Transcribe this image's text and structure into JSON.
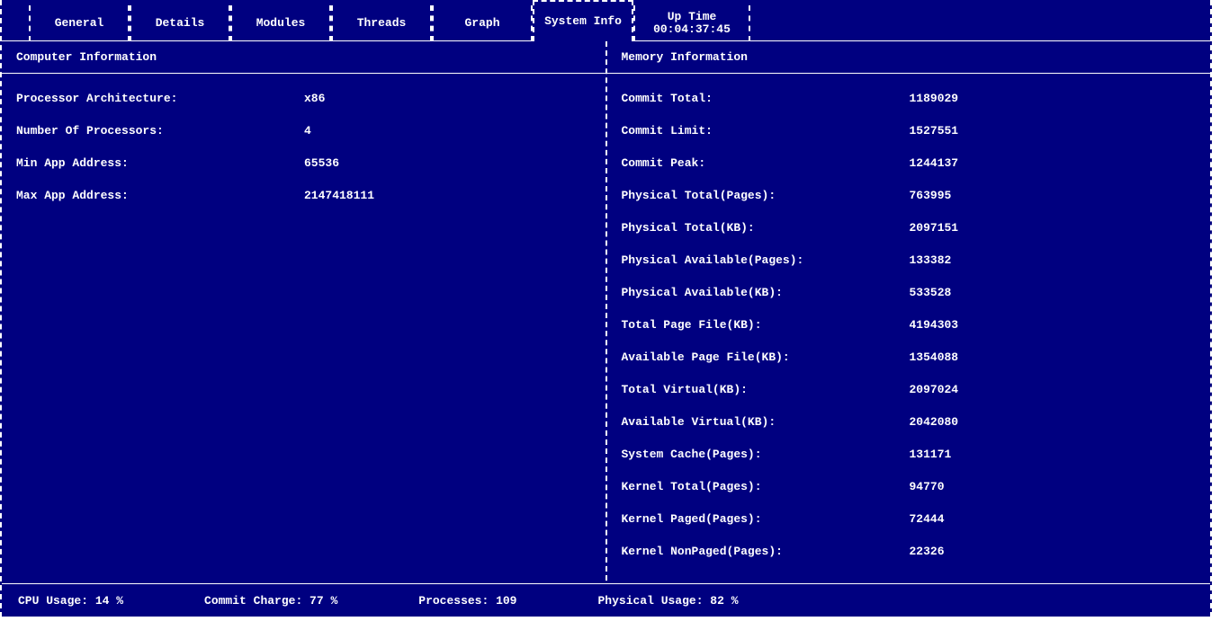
{
  "tabs": {
    "general": "General",
    "details": "Details",
    "modules": "Modules",
    "threads": "Threads",
    "graph": "Graph",
    "system_info": "System Info",
    "uptime_label": "Up Time",
    "uptime_value": "00:04:37:45"
  },
  "panel_left": {
    "title": "Computer Information",
    "rows": {
      "proc_arch_label": "Processor Architecture:",
      "proc_arch_value": "x86",
      "num_proc_label": "Number Of Processors:",
      "num_proc_value": "4",
      "min_app_label": "Min App Address:",
      "min_app_value": "65536",
      "max_app_label": "Max App Address:",
      "max_app_value": "2147418111"
    }
  },
  "panel_right": {
    "title": "Memory Information",
    "rows": {
      "commit_total_label": "Commit Total:",
      "commit_total_value": "1189029",
      "commit_limit_label": "Commit Limit:",
      "commit_limit_value": "1527551",
      "commit_peak_label": "Commit Peak:",
      "commit_peak_value": "1244137",
      "phys_total_pages_label": "Physical Total(Pages):",
      "phys_total_pages_value": "763995",
      "phys_total_kb_label": "Physical Total(KB):",
      "phys_total_kb_value": "2097151",
      "phys_avail_pages_label": "Physical Available(Pages):",
      "phys_avail_pages_value": "133382",
      "phys_avail_kb_label": "Physical Available(KB):",
      "phys_avail_kb_value": "533528",
      "total_page_file_label": "Total Page File(KB):",
      "total_page_file_value": "4194303",
      "avail_page_file_label": "Available Page File(KB):",
      "avail_page_file_value": "1354088",
      "total_virt_label": "Total Virtual(KB):",
      "total_virt_value": "2097024",
      "avail_virt_label": "Available Virtual(KB):",
      "avail_virt_value": "2042080",
      "sys_cache_label": "System Cache(Pages):",
      "sys_cache_value": "131171",
      "kernel_total_label": "Kernel Total(Pages):",
      "kernel_total_value": "94770",
      "kernel_paged_label": "Kernel Paged(Pages):",
      "kernel_paged_value": "72444",
      "kernel_nonpaged_label": "Kernel NonPaged(Pages):",
      "kernel_nonpaged_value": "22326"
    }
  },
  "status": {
    "cpu": "CPU Usage: 14 %",
    "commit": "Commit Charge: 77 %",
    "processes": "Processes: 109",
    "physical": "Physical Usage: 82 %"
  }
}
